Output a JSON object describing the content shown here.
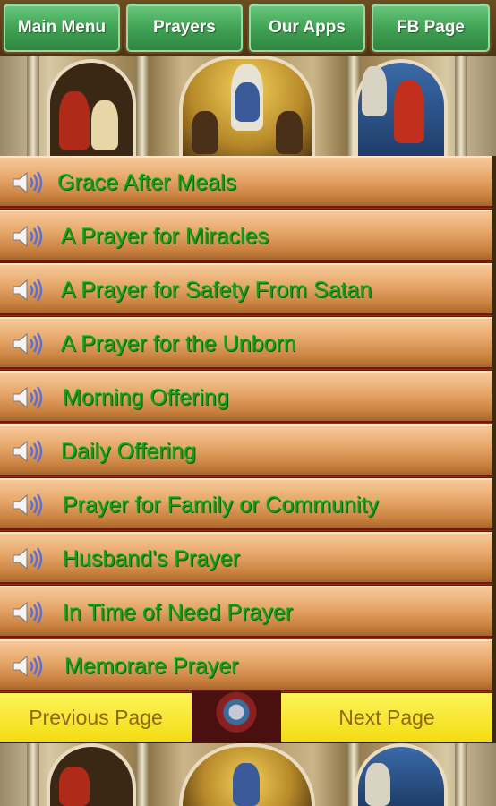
{
  "nav": {
    "main_menu": "Main Menu",
    "prayers": "Prayers",
    "our_apps": "Our Apps",
    "fb_page": "FB Page"
  },
  "prayers": [
    {
      "label": "Grace After Meals"
    },
    {
      "label": "A Prayer for Miracles"
    },
    {
      "label": "A Prayer for Safety From Satan"
    },
    {
      "label": "A Prayer for the Unborn"
    },
    {
      "label": "Morning Offering"
    },
    {
      "label": "Daily Offering"
    },
    {
      "label": "Prayer for Family or Community"
    },
    {
      "label": "Husband's Prayer"
    },
    {
      "label": "In Time of Need Prayer"
    },
    {
      "label": "Memorare Prayer"
    }
  ],
  "pager": {
    "previous": "Previous Page",
    "next": "Next Page"
  },
  "icons": {
    "row_icon": "speaker-icon"
  },
  "colors": {
    "nav_button": "#3f9f52",
    "prayer_text": "#1e9a16",
    "row_fill": "#e8a96c",
    "row_border": "#6a1e0a",
    "pager_button": "#f3dc13",
    "pager_text": "#8a6a18"
  }
}
